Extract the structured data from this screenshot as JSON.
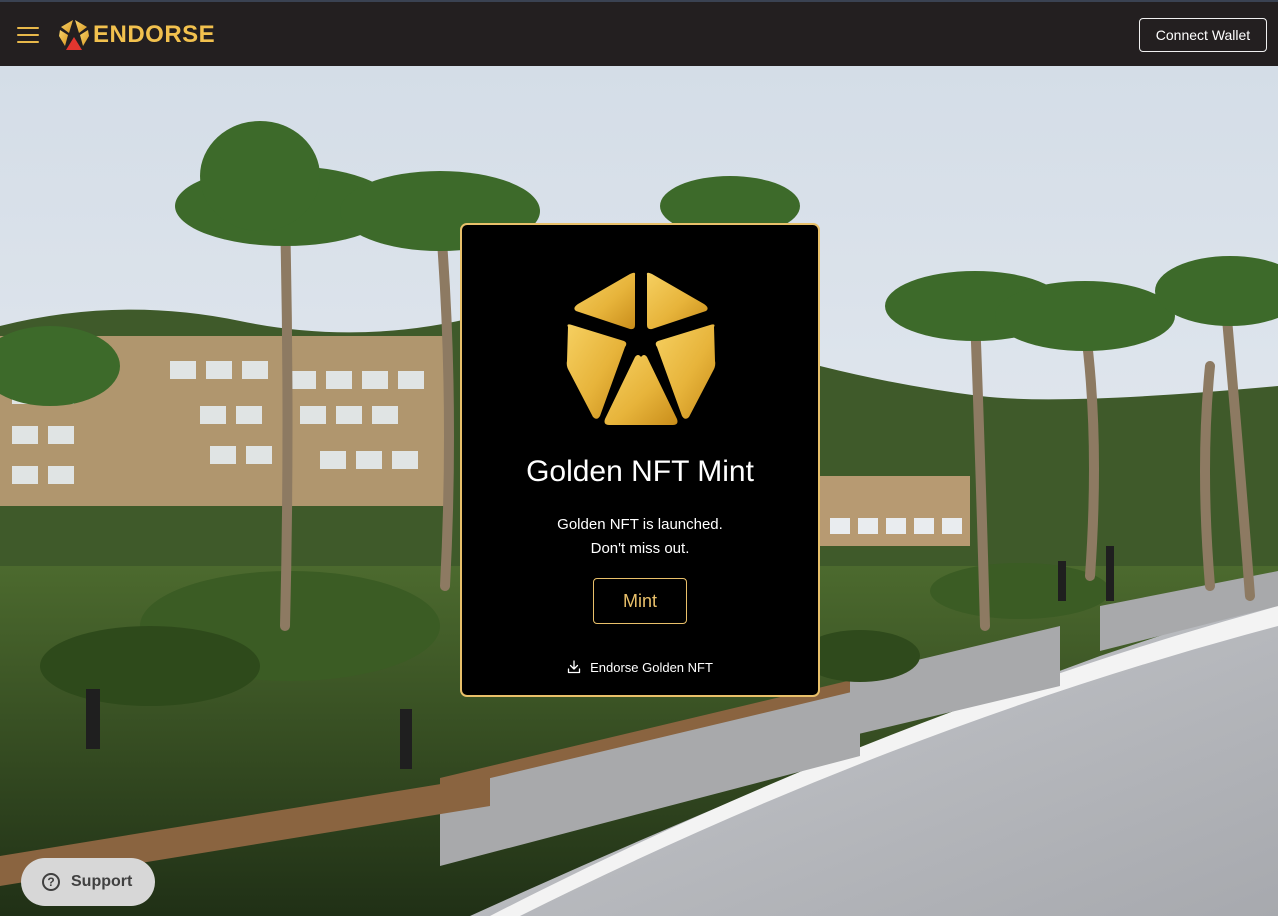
{
  "header": {
    "brand": "ENDORSE",
    "connect_wallet_label": "Connect Wallet"
  },
  "mint_card": {
    "title": "Golden NFT Mint",
    "description_line1": "Golden NFT is launched.",
    "description_line2": "Don't miss out.",
    "mint_label": "Mint",
    "download_label": "Endorse Golden NFT"
  },
  "support": {
    "label": "Support"
  },
  "colors": {
    "header_bg": "#231f20",
    "brand_gold": "#f2c14e",
    "card_border": "#e9c06a",
    "card_bg": "#000000",
    "support_bg": "#d7d7d7"
  },
  "icons": {
    "menu": "hamburger-icon",
    "brand": "endorse-logo-icon",
    "download": "download-icon",
    "support": "question-circle-icon"
  }
}
